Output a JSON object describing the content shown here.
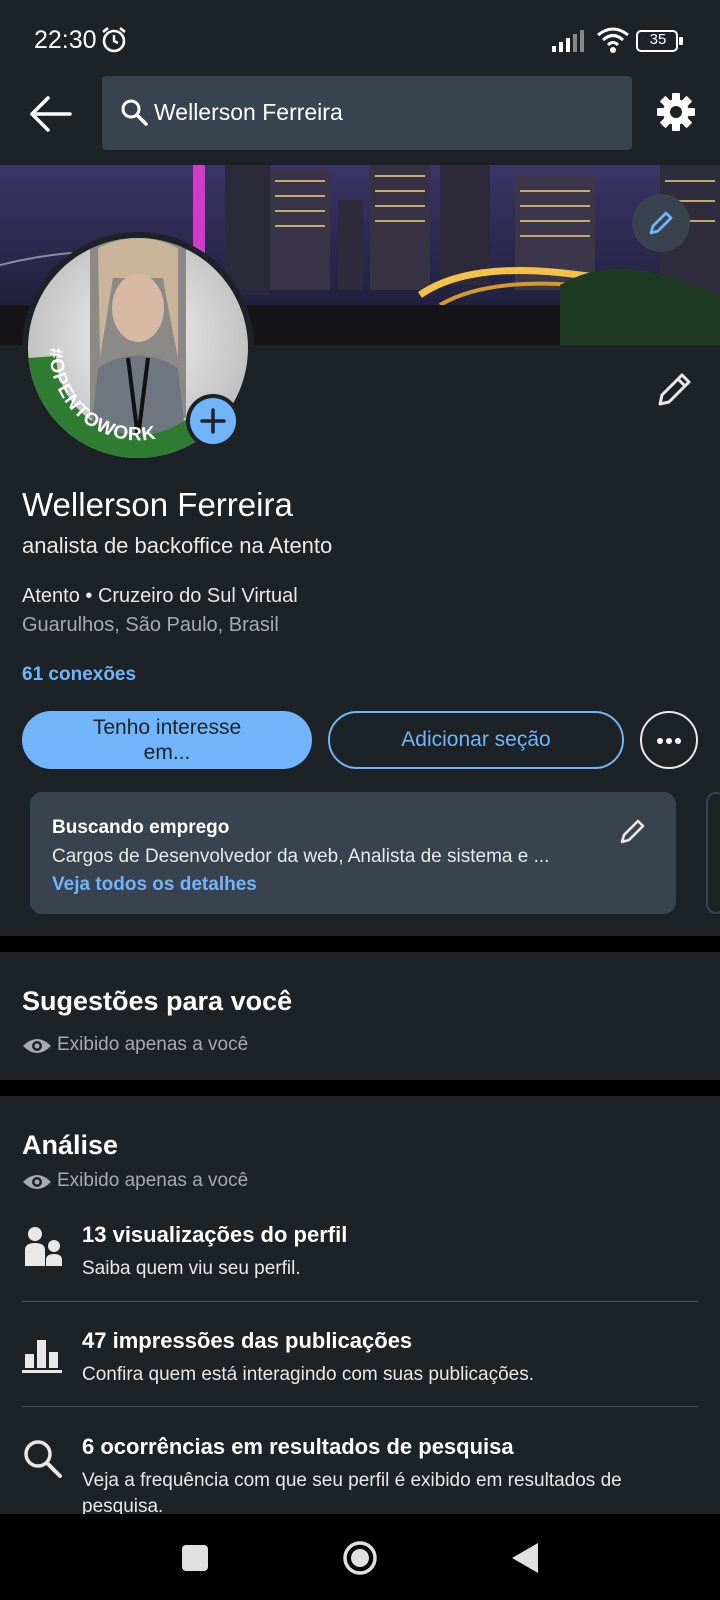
{
  "status_bar": {
    "time": "22:30",
    "battery": "35"
  },
  "search": {
    "query": "Wellerson Ferreira"
  },
  "profile": {
    "name": "Wellerson Ferreira",
    "headline": "analista de backoffice na Atento",
    "company_line": "Atento • Cruzeiro do Sul Virtual",
    "location": "Guarulhos, São Paulo, Brasil",
    "connections": "61 conexões",
    "frame_text": "#OPENTOWORK"
  },
  "actions": {
    "primary_line1": "Tenho interesse",
    "primary_line2": "em...",
    "secondary": "Adicionar seção"
  },
  "open_to_work": {
    "title": "Buscando emprego",
    "roles": "Cargos de Desenvolvedor da web, Analista de sistema e ...",
    "link": "Veja todos os detalhes"
  },
  "suggestions": {
    "title": "Sugestões para você",
    "visibility": "Exibido apenas a você"
  },
  "analytics": {
    "title": "Análise",
    "visibility": "Exibido apenas a você",
    "items": [
      {
        "icon": "people-icon",
        "title": "13 visualizações do perfil",
        "subtitle": "Saiba quem viu seu perfil."
      },
      {
        "icon": "bar-chart-icon",
        "title": "47 impressões das publicações",
        "subtitle": "Confira quem está interagindo com suas publicações."
      },
      {
        "icon": "search-icon",
        "title": "6 ocorrências em resultados de pesquisa",
        "subtitle": "Veja a frequência com que seu perfil é exibido em resultados de pesquisa."
      }
    ]
  },
  "colors": {
    "background": "#1d2226",
    "card": "#38434f",
    "accent": "#70b5f9",
    "open_to_work_green": "#2e7d32"
  }
}
